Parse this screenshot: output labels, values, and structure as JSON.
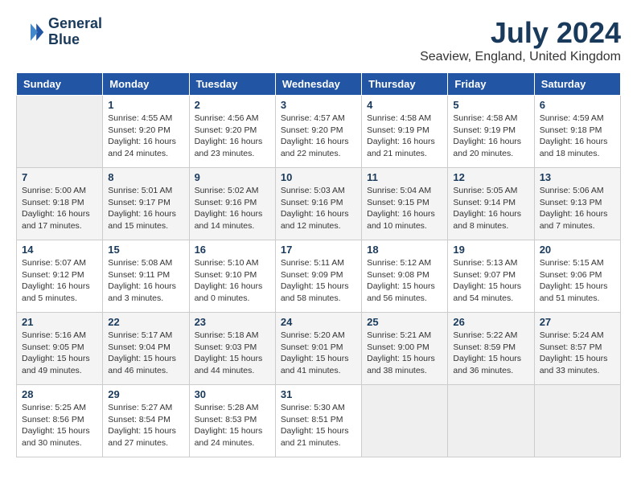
{
  "header": {
    "logo_line1": "General",
    "logo_line2": "Blue",
    "title": "July 2024",
    "location": "Seaview, England, United Kingdom"
  },
  "days_of_week": [
    "Sunday",
    "Monday",
    "Tuesday",
    "Wednesday",
    "Thursday",
    "Friday",
    "Saturday"
  ],
  "weeks": [
    [
      {
        "num": "",
        "info": ""
      },
      {
        "num": "1",
        "info": "Sunrise: 4:55 AM\nSunset: 9:20 PM\nDaylight: 16 hours\nand 24 minutes."
      },
      {
        "num": "2",
        "info": "Sunrise: 4:56 AM\nSunset: 9:20 PM\nDaylight: 16 hours\nand 23 minutes."
      },
      {
        "num": "3",
        "info": "Sunrise: 4:57 AM\nSunset: 9:20 PM\nDaylight: 16 hours\nand 22 minutes."
      },
      {
        "num": "4",
        "info": "Sunrise: 4:58 AM\nSunset: 9:19 PM\nDaylight: 16 hours\nand 21 minutes."
      },
      {
        "num": "5",
        "info": "Sunrise: 4:58 AM\nSunset: 9:19 PM\nDaylight: 16 hours\nand 20 minutes."
      },
      {
        "num": "6",
        "info": "Sunrise: 4:59 AM\nSunset: 9:18 PM\nDaylight: 16 hours\nand 18 minutes."
      }
    ],
    [
      {
        "num": "7",
        "info": "Sunrise: 5:00 AM\nSunset: 9:18 PM\nDaylight: 16 hours\nand 17 minutes."
      },
      {
        "num": "8",
        "info": "Sunrise: 5:01 AM\nSunset: 9:17 PM\nDaylight: 16 hours\nand 15 minutes."
      },
      {
        "num": "9",
        "info": "Sunrise: 5:02 AM\nSunset: 9:16 PM\nDaylight: 16 hours\nand 14 minutes."
      },
      {
        "num": "10",
        "info": "Sunrise: 5:03 AM\nSunset: 9:16 PM\nDaylight: 16 hours\nand 12 minutes."
      },
      {
        "num": "11",
        "info": "Sunrise: 5:04 AM\nSunset: 9:15 PM\nDaylight: 16 hours\nand 10 minutes."
      },
      {
        "num": "12",
        "info": "Sunrise: 5:05 AM\nSunset: 9:14 PM\nDaylight: 16 hours\nand 8 minutes."
      },
      {
        "num": "13",
        "info": "Sunrise: 5:06 AM\nSunset: 9:13 PM\nDaylight: 16 hours\nand 7 minutes."
      }
    ],
    [
      {
        "num": "14",
        "info": "Sunrise: 5:07 AM\nSunset: 9:12 PM\nDaylight: 16 hours\nand 5 minutes."
      },
      {
        "num": "15",
        "info": "Sunrise: 5:08 AM\nSunset: 9:11 PM\nDaylight: 16 hours\nand 3 minutes."
      },
      {
        "num": "16",
        "info": "Sunrise: 5:10 AM\nSunset: 9:10 PM\nDaylight: 16 hours\nand 0 minutes."
      },
      {
        "num": "17",
        "info": "Sunrise: 5:11 AM\nSunset: 9:09 PM\nDaylight: 15 hours\nand 58 minutes."
      },
      {
        "num": "18",
        "info": "Sunrise: 5:12 AM\nSunset: 9:08 PM\nDaylight: 15 hours\nand 56 minutes."
      },
      {
        "num": "19",
        "info": "Sunrise: 5:13 AM\nSunset: 9:07 PM\nDaylight: 15 hours\nand 54 minutes."
      },
      {
        "num": "20",
        "info": "Sunrise: 5:15 AM\nSunset: 9:06 PM\nDaylight: 15 hours\nand 51 minutes."
      }
    ],
    [
      {
        "num": "21",
        "info": "Sunrise: 5:16 AM\nSunset: 9:05 PM\nDaylight: 15 hours\nand 49 minutes."
      },
      {
        "num": "22",
        "info": "Sunrise: 5:17 AM\nSunset: 9:04 PM\nDaylight: 15 hours\nand 46 minutes."
      },
      {
        "num": "23",
        "info": "Sunrise: 5:18 AM\nSunset: 9:03 PM\nDaylight: 15 hours\nand 44 minutes."
      },
      {
        "num": "24",
        "info": "Sunrise: 5:20 AM\nSunset: 9:01 PM\nDaylight: 15 hours\nand 41 minutes."
      },
      {
        "num": "25",
        "info": "Sunrise: 5:21 AM\nSunset: 9:00 PM\nDaylight: 15 hours\nand 38 minutes."
      },
      {
        "num": "26",
        "info": "Sunrise: 5:22 AM\nSunset: 8:59 PM\nDaylight: 15 hours\nand 36 minutes."
      },
      {
        "num": "27",
        "info": "Sunrise: 5:24 AM\nSunset: 8:57 PM\nDaylight: 15 hours\nand 33 minutes."
      }
    ],
    [
      {
        "num": "28",
        "info": "Sunrise: 5:25 AM\nSunset: 8:56 PM\nDaylight: 15 hours\nand 30 minutes."
      },
      {
        "num": "29",
        "info": "Sunrise: 5:27 AM\nSunset: 8:54 PM\nDaylight: 15 hours\nand 27 minutes."
      },
      {
        "num": "30",
        "info": "Sunrise: 5:28 AM\nSunset: 8:53 PM\nDaylight: 15 hours\nand 24 minutes."
      },
      {
        "num": "31",
        "info": "Sunrise: 5:30 AM\nSunset: 8:51 PM\nDaylight: 15 hours\nand 21 minutes."
      },
      {
        "num": "",
        "info": ""
      },
      {
        "num": "",
        "info": ""
      },
      {
        "num": "",
        "info": ""
      }
    ]
  ]
}
